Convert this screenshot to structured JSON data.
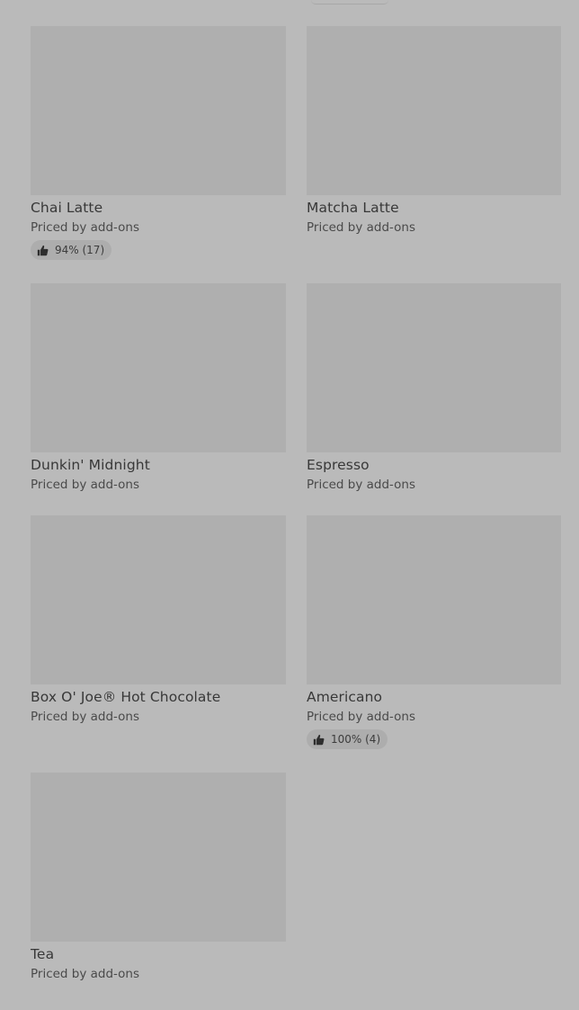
{
  "items": [
    {
      "name": "Chai Latte",
      "price": "Priced by add-ons",
      "rating": "94% (17)"
    },
    {
      "name": "Matcha Latte",
      "price": "Priced by add-ons",
      "rating": null
    },
    {
      "name": "Dunkin' Midnight",
      "price": "Priced by add-ons",
      "rating": null
    },
    {
      "name": "Espresso",
      "price": "Priced by add-ons",
      "rating": null
    },
    {
      "name": "Box O' Joe® Hot Chocolate",
      "price": "Priced by add-ons",
      "rating": null
    },
    {
      "name": "Americano",
      "price": "Priced by add-ons",
      "rating": "100% (4)"
    },
    {
      "name": "Tea",
      "price": "Priced by add-ons",
      "rating": null
    }
  ],
  "icons": {
    "rating": "thumbs-up-icon"
  },
  "colors": {
    "background": "#bababa",
    "thumbnail": "#afafaf",
    "badge": "#adadad",
    "text": "#383838"
  }
}
